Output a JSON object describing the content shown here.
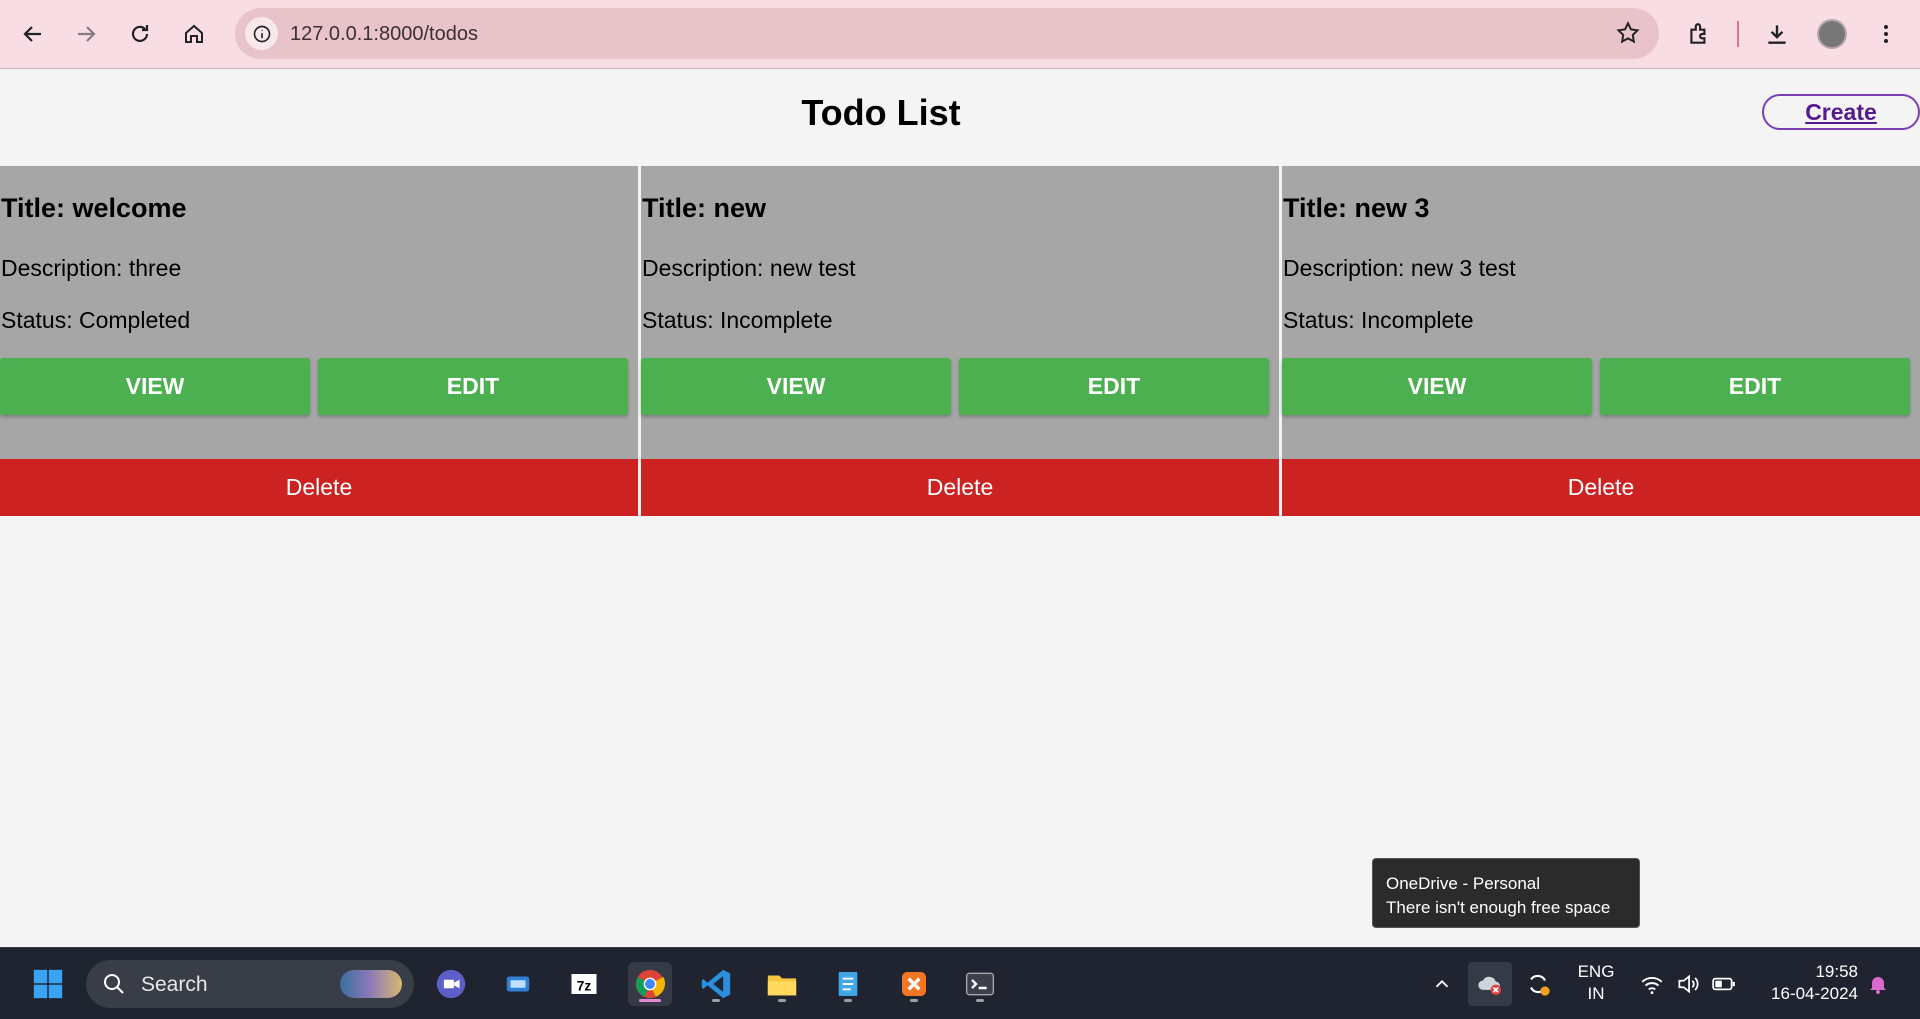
{
  "browser": {
    "url": "127.0.0.1:8000/todos"
  },
  "page": {
    "title": "Todo List",
    "create_label": "Create"
  },
  "todos": [
    {
      "title": "Title: welcome",
      "description": "Description: three",
      "status": "Status: Completed",
      "view_label": "VIEW",
      "edit_label": "EDIT",
      "delete_label": "Delete"
    },
    {
      "title": "Title: new",
      "description": "Description: new test",
      "status": "Status: Incomplete",
      "view_label": "VIEW",
      "edit_label": "EDIT",
      "delete_label": "Delete"
    },
    {
      "title": "Title: new 3",
      "description": "Description: new 3 test",
      "status": "Status: Incomplete",
      "view_label": "VIEW",
      "edit_label": "EDIT",
      "delete_label": "Delete"
    }
  ],
  "toast": {
    "title": "OneDrive - Personal",
    "message": "There isn't enough free space"
  },
  "taskbar": {
    "search_label": "Search",
    "lang_line1": "ENG",
    "lang_line2": "IN",
    "time": "19:58",
    "date": "16-04-2024"
  },
  "colors": {
    "view_edit": "#4caf50",
    "delete": "#cc2222",
    "card": "#a6a6a6",
    "chrome": "#f9dde4"
  }
}
